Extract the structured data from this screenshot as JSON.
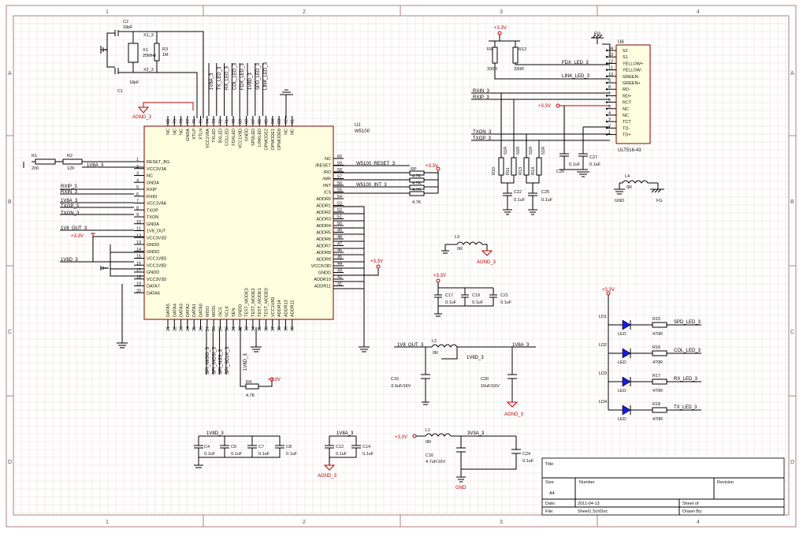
{
  "zones": {
    "cols": [
      "1",
      "2",
      "3",
      "4"
    ],
    "rows": [
      "A",
      "B",
      "C",
      "D"
    ]
  },
  "u1": {
    "ref": "U1",
    "part": "W5100",
    "left_pins": [
      {
        "num": "1",
        "name": "RESET_BG"
      },
      {
        "num": "2",
        "name": "VCC3V3A"
      },
      {
        "num": "3",
        "name": "NC"
      },
      {
        "num": "4",
        "name": "GNDA"
      },
      {
        "num": "5",
        "name": "RXIP"
      },
      {
        "num": "6",
        "name": "RXIN"
      },
      {
        "num": "7",
        "name": "VCC1V8A"
      },
      {
        "num": "8",
        "name": "TXOP"
      },
      {
        "num": "9",
        "name": "TXON"
      },
      {
        "num": "10",
        "name": "GNDA"
      },
      {
        "num": "11",
        "name": "1V8_OUT"
      },
      {
        "num": "12",
        "name": "VCC3V3D"
      },
      {
        "num": "13",
        "name": "GNDD"
      },
      {
        "num": "14",
        "name": "GNDD"
      },
      {
        "num": "15",
        "name": "VCC1V8D"
      },
      {
        "num": "16",
        "name": "VCC1V8D"
      },
      {
        "num": "17",
        "name": "GNDD"
      },
      {
        "num": "18",
        "name": "VCC3V3D"
      },
      {
        "num": "19",
        "name": "DATA7"
      },
      {
        "num": "20",
        "name": "DATA6"
      }
    ],
    "right_pins": [
      {
        "num": "60",
        "name": "NC"
      },
      {
        "num": "59",
        "name": "/RESET"
      },
      {
        "num": "58",
        "name": "/RD"
      },
      {
        "num": "57",
        "name": "/WR"
      },
      {
        "num": "56",
        "name": "/INT"
      },
      {
        "num": "55",
        "name": "/CS"
      },
      {
        "num": "54",
        "name": "ADDR0"
      },
      {
        "num": "53",
        "name": "ADDR1"
      },
      {
        "num": "52",
        "name": "ADDR2"
      },
      {
        "num": "51",
        "name": "ADDR3"
      },
      {
        "num": "50",
        "name": "ADDR4"
      },
      {
        "num": "49",
        "name": "ADDR5"
      },
      {
        "num": "48",
        "name": "ADDR6"
      },
      {
        "num": "47",
        "name": "ADDR7"
      },
      {
        "num": "46",
        "name": "ADDR8"
      },
      {
        "num": "45",
        "name": "ADDR9"
      },
      {
        "num": "44",
        "name": "VCC3V3D"
      },
      {
        "num": "43",
        "name": "GNDD"
      },
      {
        "num": "42",
        "name": "ADDR10"
      },
      {
        "num": "41",
        "name": "ADDR11"
      }
    ],
    "top_pins": [
      {
        "num": "80",
        "name": "NC"
      },
      {
        "num": "79",
        "name": "NC"
      },
      {
        "num": "78",
        "name": "NC"
      },
      {
        "num": "77",
        "name": "GNDA"
      },
      {
        "num": "76",
        "name": "XTLP"
      },
      {
        "num": "75",
        "name": "XTLN"
      },
      {
        "num": "74",
        "name": "VCC1V8A"
      },
      {
        "num": "73",
        "name": "TXLED"
      },
      {
        "num": "72",
        "name": "RXLED"
      },
      {
        "num": "71",
        "name": "COLLED"
      },
      {
        "num": "70",
        "name": "FDXLED"
      },
      {
        "num": "69",
        "name": "VCC1V8D"
      },
      {
        "num": "68",
        "name": "GNDD"
      },
      {
        "num": "67",
        "name": "SPDLED"
      },
      {
        "num": "66",
        "name": "LINKLED"
      },
      {
        "num": "65",
        "name": "OPMODE2"
      },
      {
        "num": "64",
        "name": "OPMODE1"
      },
      {
        "num": "63",
        "name": "OPMODE0"
      },
      {
        "num": "62",
        "name": "NC"
      },
      {
        "num": "61",
        "name": "NC"
      }
    ],
    "bottom_pins": [
      {
        "num": "21",
        "name": "DATA5"
      },
      {
        "num": "22",
        "name": "DATA4"
      },
      {
        "num": "23",
        "name": "DATA3"
      },
      {
        "num": "24",
        "name": "DATA2"
      },
      {
        "num": "25",
        "name": "DATA1"
      },
      {
        "num": "26",
        "name": "DATA0"
      },
      {
        "num": "27",
        "name": "MISO"
      },
      {
        "num": "28",
        "name": "MOSI"
      },
      {
        "num": "29",
        "name": "/SCS"
      },
      {
        "num": "30",
        "name": "SCLK"
      },
      {
        "num": "31",
        "name": "SEN"
      },
      {
        "num": "32",
        "name": "GNDD"
      },
      {
        "num": "33",
        "name": "TEST_MODE3"
      },
      {
        "num": "34",
        "name": "TEST_MODE2"
      },
      {
        "num": "35",
        "name": "TEST_MODE1"
      },
      {
        "num": "36",
        "name": "TEST_MODE0"
      },
      {
        "num": "37",
        "name": "VCC1V8D"
      },
      {
        "num": "38",
        "name": "ADDR14"
      },
      {
        "num": "39",
        "name": "ADDR13"
      },
      {
        "num": "40",
        "name": "ADDR12"
      }
    ]
  },
  "top_nets": [
    "1V8A_3",
    "TX_LED_3",
    "RX_LED_3",
    "COL_LED_3",
    "FDX_LED_3",
    "1V8D_3",
    "SPD_LED_3",
    "LINK_LED_3"
  ],
  "left_nets": {
    "v1v8a": "1V8A_3",
    "rxip": "RXIP_3",
    "rxin": "RXIN_3",
    "v1v8a2": "1V8A_3",
    "txop": "TXOP_3",
    "txon": "TXON_3",
    "v18out": "1V8_OUT_3",
    "v33": "+3.3V",
    "v1v8d": "1V8D_3"
  },
  "right_nets": {
    "reset": "W5100_RESET_3",
    "int": "W5100_INT_3"
  },
  "bottom_nets": [
    "SPI_MISO_3",
    "SPI_MOSI_3",
    "SPI_NSS_3",
    "SPI_SCLK_3"
  ],
  "bottom_net_1v8d": "1V8D_3",
  "resistors": {
    "r1": {
      "ref": "R1",
      "val": "200"
    },
    "r2": {
      "ref": "R2",
      "val": "12K"
    },
    "r3": {
      "ref": "R3",
      "val": "1M"
    },
    "r4": {
      "ref": "R4",
      "val": "4.7K"
    },
    "rp": {
      "ref": "RP",
      "val": "4.7K",
      "vals": [
        "4.7K",
        "4.7K",
        "4.7K",
        "4.7K"
      ]
    },
    "r9": {
      "ref": "R9",
      "val": "330R"
    },
    "r12": {
      "ref": "R12",
      "val": "330R"
    },
    "r10": {
      "ref": "R10",
      "val": "51R"
    },
    "r11": {
      "ref": "R11",
      "val": "51R"
    },
    "r13": {
      "ref": "R13",
      "val": "51R"
    },
    "r14": {
      "ref": "R14",
      "val": "51R"
    },
    "r15": {
      "ref": "R15",
      "val": "470R"
    },
    "r16": {
      "ref": "R16",
      "val": "470R"
    },
    "r17": {
      "ref": "R17",
      "val": "470R"
    },
    "r18": {
      "ref": "R18",
      "val": "470R"
    }
  },
  "crystal": {
    "ref": "X1",
    "val": "25MHz",
    "n1": "X1_3",
    "n2": "X2_3",
    "c2": "C2",
    "c2v": "18pF",
    "c1": "C1",
    "c1v": "18pF"
  },
  "u6": {
    "ref": "U6",
    "part": "ULT516-43",
    "fg": "FG",
    "pins": [
      {
        "num": "14",
        "name": "S2"
      },
      {
        "num": "13",
        "name": "S1"
      },
      {
        "num": "12",
        "name": "YELLOW+"
      },
      {
        "num": "11",
        "name": "YELLOW-"
      },
      {
        "num": "10",
        "name": "GREEN-"
      },
      {
        "num": "9",
        "name": "GREEN+"
      },
      {
        "num": "8",
        "name": "RD-"
      },
      {
        "num": "7",
        "name": "RD+"
      },
      {
        "num": "6",
        "name": "RCT"
      },
      {
        "num": "5",
        "name": "NC"
      },
      {
        "num": "4",
        "name": "NC"
      },
      {
        "num": "3",
        "name": "TCT"
      },
      {
        "num": "2",
        "name": "TD-"
      },
      {
        "num": "1",
        "name": "TD+"
      }
    ],
    "nets": {
      "fdx": "FDX_LED_3",
      "link": "LINK_LED_3",
      "rxin": "RXIN_3",
      "rxip": "RXIP_3",
      "txon": "TXON_3",
      "txop": "TXOP_3"
    }
  },
  "caps": {
    "c22": {
      "ref": "C22",
      "val": "0.1uF"
    },
    "c25": {
      "ref": "C25",
      "val": "0.1uF"
    },
    "c26": {
      "ref": "C26",
      "val": "0.1uF"
    },
    "c27": {
      "ref": "C27",
      "val": "0.1uF"
    },
    "c17": {
      "ref": "C17",
      "val": "0.1uF"
    },
    "c19": {
      "ref": "C19",
      "val": "0.1uF"
    },
    "c21": {
      "ref": "C21",
      "val": "0.1uF"
    },
    "c15": {
      "ref": "C15",
      "val": "3.3uF/16V"
    },
    "c20": {
      "ref": "C20",
      "val": "10uF/16V"
    },
    "c4": {
      "ref": "C4",
      "val": "0.1uF"
    },
    "c6": {
      "ref": "C6",
      "val": "0.1uF"
    },
    "c7": {
      "ref": "C7",
      "val": "0.1uF"
    },
    "c8": {
      "ref": "C8",
      "val": "0.1uF"
    },
    "c12": {
      "ref": "C12",
      "val": "0.1uF"
    },
    "c14": {
      "ref": "C14",
      "val": "0.1uF"
    },
    "c16": {
      "ref": "C16",
      "val": "4.7uF/16V"
    },
    "c24": {
      "ref": "C24",
      "val": "0.1uF"
    }
  },
  "inductors": {
    "l4": {
      "ref": "L4",
      "val": "0R"
    },
    "l3": {
      "ref": "L3",
      "val": "0R"
    },
    "l2": {
      "ref": "L2",
      "val": "0R"
    },
    "l1": {
      "ref": "L1",
      "val": "0R"
    }
  },
  "nets": {
    "p33": "+3.3V",
    "agnd": "AGND_3",
    "gnd": "GND",
    "fg": "FG",
    "v1v8out": "1V8_OUT_3",
    "v1v8a": "1V8A_3",
    "v1v8d": "1V8D_3",
    "v3v3a": "3V3A_3"
  },
  "leds": [
    {
      "ref": "LD1",
      "label": "LED",
      "res": "R15",
      "val": "470R",
      "net": "SPD_LED_3"
    },
    {
      "ref": "LD2",
      "label": "LED",
      "res": "R16",
      "val": "470R",
      "net": "COL_LED_3"
    },
    {
      "ref": "LD3",
      "label": "LED",
      "res": "R17",
      "val": "470R",
      "net": "RX_LED_3"
    },
    {
      "ref": "LD4",
      "label": "LED",
      "res": "R18",
      "val": "470R",
      "net": "TX_LED_3"
    }
  ],
  "title_block": {
    "title": "Title",
    "size": "Size",
    "size_val": "A4",
    "number": "Number",
    "revision": "Revision",
    "date": "Date:",
    "date_val": "2011-04-13",
    "sheet": "Sheet   of",
    "file": "File:",
    "file_val": "Sheet1.SchDoc",
    "drawn": "Drawn By:"
  }
}
